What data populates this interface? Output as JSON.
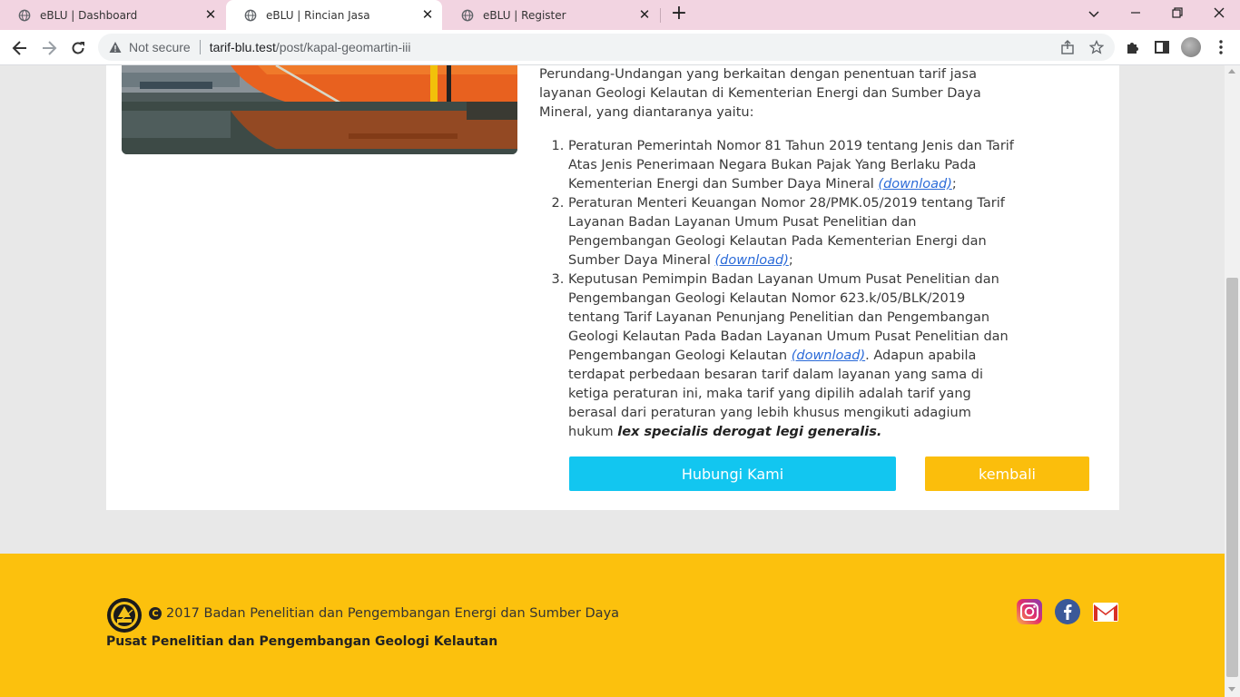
{
  "browser": {
    "tabs": [
      {
        "title": "eBLU | Dashboard",
        "active": false
      },
      {
        "title": "eBLU | Rincian Jasa",
        "active": true
      },
      {
        "title": "eBLU | Register",
        "active": false
      }
    ],
    "security_label": "Not secure",
    "url_host": "tarif-blu.test",
    "url_path": "/post/kapal-geomartin-iii"
  },
  "content": {
    "intro": "Perundang-Undangan yang berkaitan dengan penentuan tarif jasa layanan Geologi Kelautan di Kementerian Energi dan Sumber Daya Mineral, yang diantaranya yaitu:",
    "regulations": [
      {
        "text": "Peraturan Pemerintah Nomor 81 Tahun 2019 tentang Jenis dan Tarif Atas Jenis Penerimaan Negara Bukan Pajak Yang Berlaku Pada Kementerian Energi dan Sumber Daya Mineral ",
        "link": "(download)",
        "after": ";"
      },
      {
        "text": "Peraturan Menteri Keuangan Nomor 28/PMK.05/2019 tentang Tarif Layanan Badan Layanan Umum Pusat Penelitian dan Pengembangan Geologi Kelautan Pada Kementerian Energi dan Sumber Daya Mineral ",
        "link": "(download)",
        "after": ";"
      },
      {
        "text": "Keputusan Pemimpin Badan Layanan Umum Pusat Penelitian dan Pengembangan Geologi Kelautan Nomor 623.k/05/BLK/2019 tentang Tarif Layanan Penunjang Penelitian dan Pengembangan Geologi Kelautan Pada Badan Layanan Umum Pusat Penelitian dan Pengembangan Geologi Kelautan ",
        "link": "(download)",
        "after": ". Adapun apabila terdapat perbedaan besaran tarif dalam layanan yang sama di ketiga peraturan ini, maka tarif yang dipilih adalah tarif yang berasal dari peraturan yang lebih khusus mengikuti adagium hukum ",
        "emphasis": "lex specialis derogat legi generalis."
      }
    ],
    "contact_button": "Hubungi Kami",
    "back_button": "kembali"
  },
  "footer": {
    "copyright": "2017 Badan Penelitian dan Pengembangan Energi dan Sumber Daya",
    "organization": "Pusat Penelitian dan Pengembangan Geologi Kelautan",
    "social_icons": [
      "instagram-icon",
      "facebook-icon",
      "gmail-icon"
    ]
  },
  "colors": {
    "tab_bar": "#f2d4e1",
    "contact_button": "#12c6f0",
    "back_button": "#fbbe0c",
    "footer": "#fcc10d",
    "link": "#2a6ad8"
  }
}
